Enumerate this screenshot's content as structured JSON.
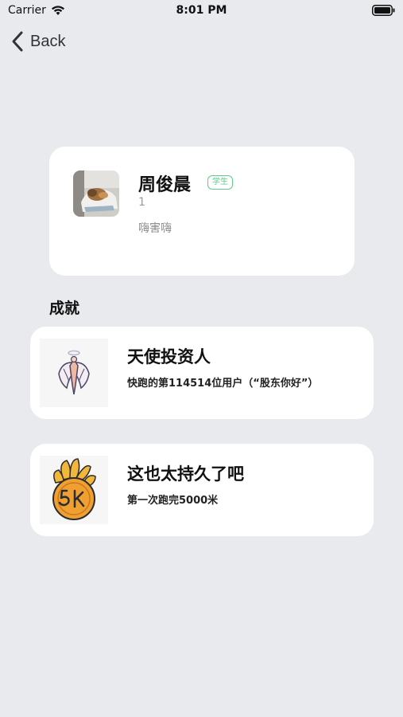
{
  "status_bar": {
    "carrier": "Carrier",
    "time": "8:01 PM"
  },
  "nav": {
    "back_label": "Back"
  },
  "profile": {
    "name": "周俊晨",
    "role_badge": "学生",
    "user_id": "1",
    "bio": "嗨害嗨"
  },
  "achievements_section": {
    "title": "成就",
    "items": [
      {
        "title": "天使投资人",
        "description": "快跑的第114514位用户（“股东你好”）",
        "icon": "angel-wings-icon"
      },
      {
        "title": "这也太持久了吧",
        "description": "第一次跑完5000米",
        "icon": "5k-medal-icon"
      }
    ]
  },
  "colors": {
    "background": "#e9eaee",
    "card": "#ffffff",
    "badge_green": "#5ccf8a",
    "medal_orange": "#f0a030"
  }
}
